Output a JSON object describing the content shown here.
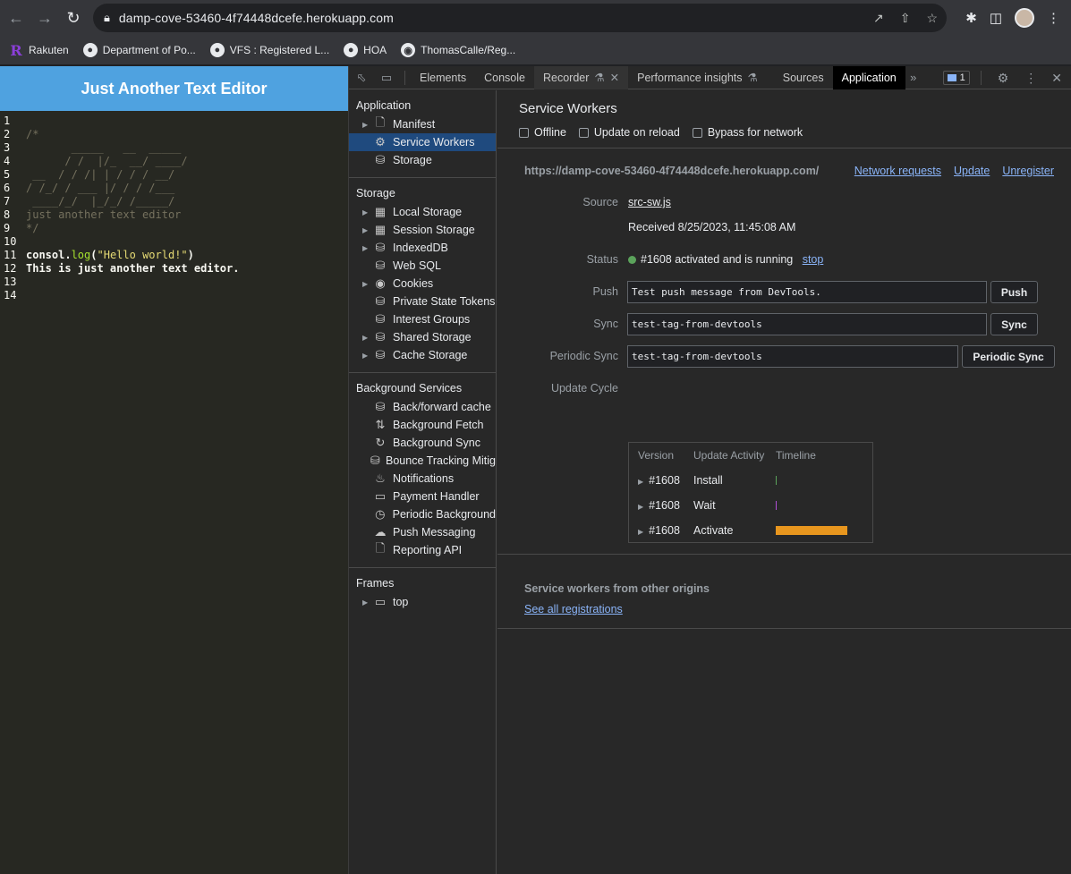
{
  "browser": {
    "url": "damp-cove-53460-4f74448dcefe.herokuapp.com",
    "bookmarks": [
      "Rakuten",
      "Department of Po...",
      "VFS : Registered L...",
      "HOA",
      "ThomasCalle/Reg..."
    ]
  },
  "app": {
    "title": "Just Another Text Editor",
    "lines": [
      {
        "n": "1",
        "text": "",
        "type": "plain"
      },
      {
        "n": "2",
        "text": "/*",
        "type": "comment"
      },
      {
        "n": "3",
        "text": "       _____   __  _____",
        "type": "comment"
      },
      {
        "n": "4",
        "text": "      / /  |/_  __/ ____/",
        "type": "comment"
      },
      {
        "n": "5",
        "text": " __  / / /| | / / / __/",
        "type": "comment"
      },
      {
        "n": "6",
        "text": "/ /_/ / ___ |/ / / /___",
        "type": "comment"
      },
      {
        "n": "7",
        "text": " ____/_/  |_/_/ /_____/",
        "type": "comment"
      },
      {
        "n": "8",
        "text": "just another text editor",
        "type": "comment"
      },
      {
        "n": "9",
        "text": "*/",
        "type": "comment"
      },
      {
        "n": "10",
        "text": "",
        "type": "plain"
      },
      {
        "n": "11",
        "text": "consol.log(\"Hello world!\")",
        "type": "code"
      },
      {
        "n": "12",
        "text": "This is just another text editor.",
        "type": "plain"
      },
      {
        "n": "13",
        "text": "",
        "type": "plain"
      },
      {
        "n": "14",
        "text": "",
        "type": "plain"
      }
    ],
    "code_parts": {
      "obj": "consol.",
      "fn": "log",
      "open": "(",
      "str": "\"Hello world!\"",
      "close": ")"
    }
  },
  "devtools": {
    "tabs": [
      "Elements",
      "Console",
      "Recorder",
      "Performance insights",
      "Sources",
      "Application"
    ],
    "issues_count": "1",
    "sidebar": {
      "application_title": "Application",
      "application_items": [
        "Manifest",
        "Service Workers",
        "Storage"
      ],
      "storage_title": "Storage",
      "storage_items": [
        "Local Storage",
        "Session Storage",
        "IndexedDB",
        "Web SQL",
        "Cookies",
        "Private State Tokens",
        "Interest Groups",
        "Shared Storage",
        "Cache Storage"
      ],
      "background_title": "Background Services",
      "background_items": [
        "Back/forward cache",
        "Background Fetch",
        "Background Sync",
        "Bounce Tracking Mitig",
        "Notifications",
        "Payment Handler",
        "Periodic Background",
        "Push Messaging",
        "Reporting API"
      ],
      "frames_title": "Frames",
      "frames_items": [
        "top"
      ]
    },
    "main": {
      "title": "Service Workers",
      "options": [
        "Offline",
        "Update on reload",
        "Bypass for network"
      ],
      "origin": "https://damp-cove-53460-4f74448dcefe.herokuapp.com/",
      "origin_links": [
        "Network requests",
        "Update",
        "Unregister"
      ],
      "source_label": "Source",
      "source_link": "src-sw.js",
      "received": "Received 8/25/2023, 11:45:08 AM",
      "status_label": "Status",
      "status_text": "#1608 activated and is running",
      "status_link": "stop",
      "push_label": "Push",
      "push_value": "Test push message from DevTools.",
      "push_button": "Push",
      "sync_label": "Sync",
      "sync_value": "test-tag-from-devtools",
      "sync_button": "Sync",
      "periodic_label": "Periodic Sync",
      "periodic_value": "test-tag-from-devtools",
      "periodic_button": "Periodic Sync",
      "update_cycle_label": "Update Cycle",
      "update_cycle": {
        "headers": [
          "Version",
          "Update Activity",
          "Timeline"
        ],
        "rows": [
          {
            "version": "#1608",
            "activity": "Install",
            "bar_start": 0.0,
            "bar_width": 0.01,
            "color": "#5ba35b"
          },
          {
            "version": "#1608",
            "activity": "Wait",
            "bar_start": 0.0,
            "bar_width": 0.01,
            "color": "#b04fd6"
          },
          {
            "version": "#1608",
            "activity": "Activate",
            "bar_start": 0.0,
            "bar_width": 1.0,
            "color": "#e8961e"
          }
        ]
      },
      "other_origins_title": "Service workers from other origins",
      "see_all": "See all registrations"
    }
  }
}
